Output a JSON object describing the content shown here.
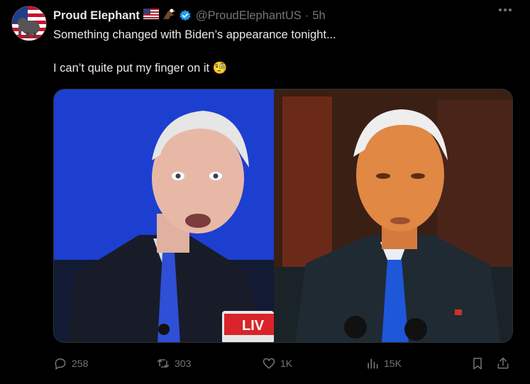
{
  "author": {
    "name": "Proud Elephant",
    "emojis": [
      "flag-us",
      "eagle"
    ],
    "handle": "@ProudElephantUS",
    "separator": "·",
    "time": "5h",
    "verified": true
  },
  "tweet": {
    "line1": "Something changed with Biden’s appearance tonight...",
    "line2": "I can’t quite put my finger on it 🧐"
  },
  "media": {
    "left_background": "#1c3fd0",
    "right_background": "#3a1f15",
    "badge_text": "LIV"
  },
  "stats": {
    "replies": "258",
    "reposts": "303",
    "likes": "1K",
    "views": "15K"
  },
  "colors": {
    "text": "#e7e9ea",
    "muted": "#71767b",
    "verified": "#1d9bf0",
    "background": "#000000"
  }
}
